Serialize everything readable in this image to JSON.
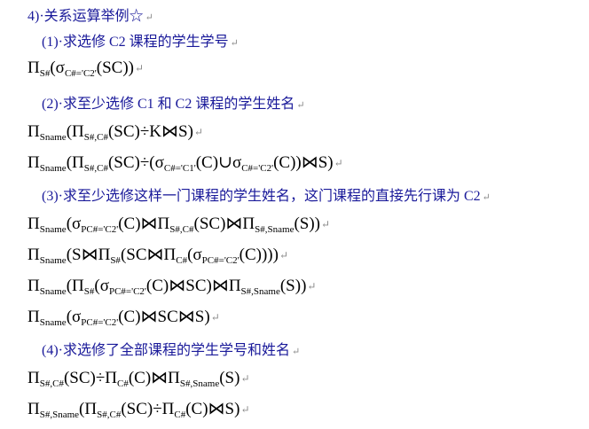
{
  "headings": {
    "h4": "4)·关系运算举例☆",
    "q1": "(1)·求选修 C2 课程的学生学号",
    "q2": "(2)·求至少选修 C1 和 C2 课程的学生姓名",
    "q3": "(3)·求至少选修这样一门课程的学生姓名，这门课程的直接先行课为 C2",
    "q4": "(4)·求选修了全部课程的学生学号和姓名"
  },
  "paragraph_mark": "↵",
  "formulas": {
    "f1": [
      {
        "t": "Π"
      },
      {
        "s": "S#"
      },
      {
        "t": "(σ"
      },
      {
        "s": "C#='C2'"
      },
      {
        "t": "(SC))"
      }
    ],
    "f2": [
      {
        "t": "Π"
      },
      {
        "s": "Sname"
      },
      {
        "t": "(Π"
      },
      {
        "s": "S#,C#"
      },
      {
        "t": "(SC)÷K⋈S)"
      }
    ],
    "f3": [
      {
        "t": "Π"
      },
      {
        "s": "Sname"
      },
      {
        "t": "(Π"
      },
      {
        "s": "S#,C#"
      },
      {
        "t": "(SC)÷(σ"
      },
      {
        "s": "C#='C1'"
      },
      {
        "t": "(C)∪σ"
      },
      {
        "s": "C#='C2'"
      },
      {
        "t": "(C))⋈S)"
      }
    ],
    "f4": [
      {
        "t": "Π"
      },
      {
        "s": "Sname"
      },
      {
        "t": "(σ"
      },
      {
        "s": "PC#='C2'"
      },
      {
        "t": "(C)⋈Π"
      },
      {
        "s": "S#,C#"
      },
      {
        "t": "(SC)⋈Π"
      },
      {
        "s": "S#,Sname"
      },
      {
        "t": "(S))"
      }
    ],
    "f5": [
      {
        "t": "Π"
      },
      {
        "s": "Sname"
      },
      {
        "t": "(S⋈Π"
      },
      {
        "s": "S#"
      },
      {
        "t": "(SC⋈Π"
      },
      {
        "s": "C#"
      },
      {
        "t": "(σ"
      },
      {
        "s": "PC#='C2'"
      },
      {
        "t": "(C))))"
      }
    ],
    "f6": [
      {
        "t": "Π"
      },
      {
        "s": "Sname"
      },
      {
        "t": "(Π"
      },
      {
        "s": "S#"
      },
      {
        "t": "(σ"
      },
      {
        "s": "PC#='C2'"
      },
      {
        "t": "(C)⋈SC)⋈Π"
      },
      {
        "s": "S#,Sname"
      },
      {
        "t": "(S))"
      }
    ],
    "f7": [
      {
        "t": "Π"
      },
      {
        "s": "Sname"
      },
      {
        "t": "(σ"
      },
      {
        "s": "PC#='C2'"
      },
      {
        "t": "(C)⋈SC⋈S)"
      }
    ],
    "f8": [
      {
        "t": "Π"
      },
      {
        "s": "S#,C#"
      },
      {
        "t": "(SC)÷Π"
      },
      {
        "s": "C#"
      },
      {
        "t": "(C)⋈Π"
      },
      {
        "s": "S#,Sname"
      },
      {
        "t": "(S)"
      }
    ],
    "f9": [
      {
        "t": "Π"
      },
      {
        "s": "S#,Sname"
      },
      {
        "t": "(Π"
      },
      {
        "s": "S#,C#"
      },
      {
        "t": "(SC)÷Π"
      },
      {
        "s": "C#"
      },
      {
        "t": "(C)⋈S)"
      }
    ]
  }
}
